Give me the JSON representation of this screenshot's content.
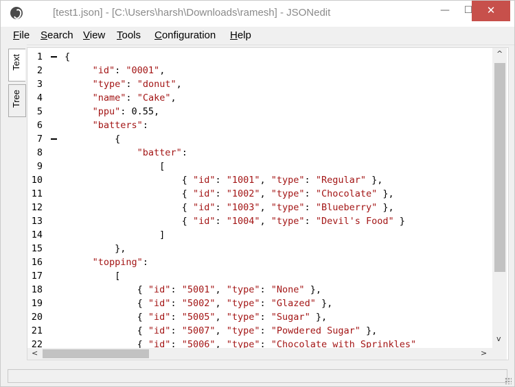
{
  "window": {
    "title": "[test1.json] - [C:\\Users\\harsh\\Downloads\\ramesh] - JSONedit",
    "minimize_glyph": "—",
    "maximize_glyph": "☐",
    "close_glyph": "✕",
    "close_color": "#c7504b"
  },
  "menu": [
    {
      "label": "File",
      "accel": "F"
    },
    {
      "label": "Search",
      "accel": "S"
    },
    {
      "label": "View",
      "accel": "V"
    },
    {
      "label": "Tools",
      "accel": "T"
    },
    {
      "label": "Configuration",
      "accel": "C"
    },
    {
      "label": "Help",
      "accel": "H"
    }
  ],
  "side_tabs": [
    {
      "label": "Text",
      "active": true
    },
    {
      "label": "Tree",
      "active": false
    }
  ],
  "editor": {
    "lines": [
      {
        "n": "1",
        "fold": true,
        "text": "{"
      },
      {
        "n": "2",
        "text": "     \"id\": \"0001\","
      },
      {
        "n": "3",
        "text": "     \"type\": \"donut\","
      },
      {
        "n": "4",
        "text": "     \"name\": \"Cake\","
      },
      {
        "n": "5",
        "text": "     \"ppu\": 0.55,"
      },
      {
        "n": "6",
        "text": "     \"batters\":"
      },
      {
        "n": "7",
        "fold": true,
        "text": "         {"
      },
      {
        "n": "8",
        "text": "             \"batter\":"
      },
      {
        "n": "9",
        "text": "                 ["
      },
      {
        "n": "10",
        "text": "                     { \"id\": \"1001\", \"type\": \"Regular\" },"
      },
      {
        "n": "11",
        "text": "                     { \"id\": \"1002\", \"type\": \"Chocolate\" },"
      },
      {
        "n": "12",
        "text": "                     { \"id\": \"1003\", \"type\": \"Blueberry\" },"
      },
      {
        "n": "13",
        "text": "                     { \"id\": \"1004\", \"type\": \"Devil's Food\" }"
      },
      {
        "n": "14",
        "text": "                 ]"
      },
      {
        "n": "15",
        "text": "         },"
      },
      {
        "n": "16",
        "text": "     \"topping\":"
      },
      {
        "n": "17",
        "text": "         ["
      },
      {
        "n": "18",
        "text": "             { \"id\": \"5001\", \"type\": \"None\" },"
      },
      {
        "n": "19",
        "text": "             { \"id\": \"5002\", \"type\": \"Glazed\" },"
      },
      {
        "n": "20",
        "text": "             { \"id\": \"5005\", \"type\": \"Sugar\" },"
      },
      {
        "n": "21",
        "text": "             { \"id\": \"5007\", \"type\": \"Powdered Sugar\" },"
      },
      {
        "n": "22",
        "text": "             { \"id\": \"5006\", \"type\": \"Chocolate with Sprinkles\""
      }
    ],
    "string_color": "#a31515",
    "scroll_up": "^",
    "scroll_down": "v",
    "scroll_left": "<",
    "scroll_right": ">"
  }
}
